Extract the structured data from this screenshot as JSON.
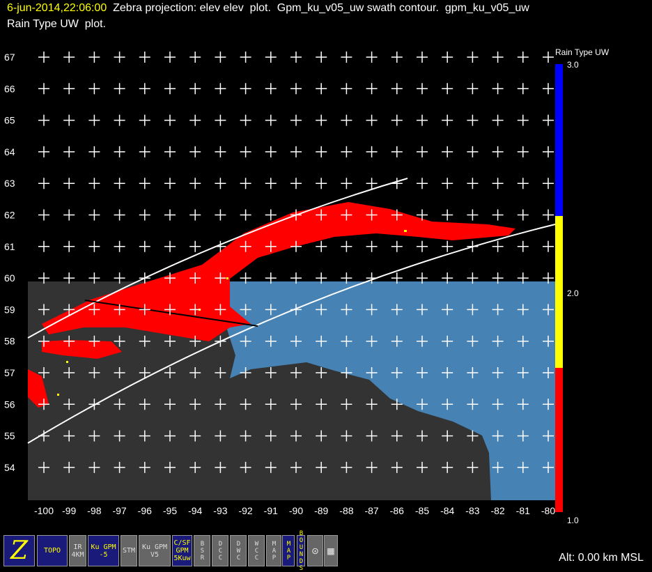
{
  "title": {
    "time": "6-jun-2014,22:06:00",
    "line1": "Zebra projection: elev elev  plot.  Gpm_ku_v05_uw swath contour.  gpm_ku_v05_uw",
    "line2": "Rain Type UW  plot."
  },
  "axes": {
    "lon_ticks": [
      "-100",
      "-99",
      "-98",
      "-97",
      "-96",
      "-95",
      "-94",
      "-93",
      "-92",
      "-91",
      "-90",
      "-89",
      "-88",
      "-87",
      "-86",
      "-85",
      "-84",
      "-83",
      "-82",
      "-81",
      "-80"
    ],
    "lat_ticks": [
      "67",
      "66",
      "65",
      "64",
      "63",
      "62",
      "61",
      "60",
      "59",
      "58",
      "57",
      "56",
      "55",
      "54"
    ]
  },
  "colorbar": {
    "title": "Rain Type UW",
    "labels": [
      "3.0",
      "2.0",
      "1.0"
    ],
    "colors": {
      "high": "#0000ff",
      "mid": "#ffff00",
      "low": "#ff0000"
    }
  },
  "colors": {
    "land": "#333333",
    "water": "#4682b4",
    "rain": "#ff0000",
    "swath": "#ffffff"
  },
  "toolbar": [
    {
      "label": "Z",
      "style": "blue"
    },
    {
      "label": "TOPO",
      "style": "blue"
    },
    {
      "label": "IR 4KM",
      "style": "gray"
    },
    {
      "label": "Ku GPM -5",
      "style": "blue"
    },
    {
      "label": "STM",
      "style": "gray"
    },
    {
      "label": "Ku GPM V5",
      "style": "gray"
    },
    {
      "label": "C/SF GPM 5Kuw",
      "style": "blue"
    },
    {
      "label": "BSR",
      "style": "gray"
    },
    {
      "label": "DCC",
      "style": "gray"
    },
    {
      "label": "DWC",
      "style": "gray"
    },
    {
      "label": "WCC",
      "style": "gray"
    },
    {
      "label": "MAP",
      "style": "gray"
    },
    {
      "label": "MAP",
      "style": "blue"
    },
    {
      "label": "BOUNDS",
      "style": "blue"
    },
    {
      "label": "⊙",
      "style": "gray"
    },
    {
      "label": "▦",
      "style": "gray"
    }
  ],
  "status": {
    "altitude": "Alt: 0.00 km MSL"
  }
}
